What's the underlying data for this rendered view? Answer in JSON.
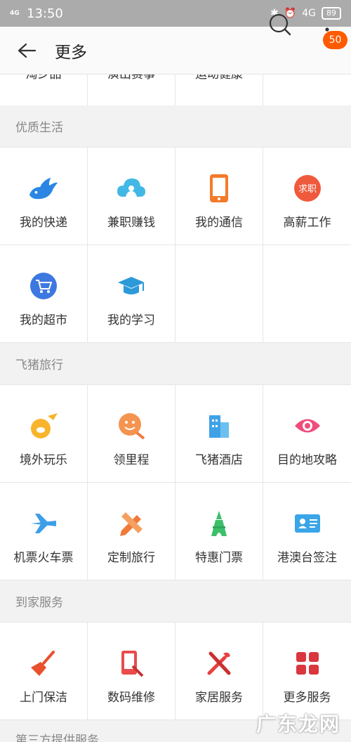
{
  "status_bar": {
    "network": "4G",
    "time": "13:50",
    "network2": "4G",
    "battery": "89"
  },
  "header": {
    "title": "更多",
    "badge": "50"
  },
  "top_partial_items": [
    "淘乡品",
    "演出赛事",
    "运动健康",
    ""
  ],
  "sections": [
    {
      "title": "优质生活",
      "items": [
        {
          "label": "我的快递",
          "icon": "bird-delivery-icon"
        },
        {
          "label": "兼职赚钱",
          "icon": "cloud-person-icon"
        },
        {
          "label": "我的通信",
          "icon": "phone-icon"
        },
        {
          "label": "高薪工作",
          "icon": "job-seek-icon",
          "icon_text": "求职"
        },
        {
          "label": "我的超市",
          "icon": "cart-icon"
        },
        {
          "label": "我的学习",
          "icon": "graduation-cap-icon"
        }
      ]
    },
    {
      "title": "飞猪旅行",
      "items": [
        {
          "label": "境外玩乐",
          "icon": "pig-plane-icon"
        },
        {
          "label": "领里程",
          "icon": "smiley-pen-icon"
        },
        {
          "label": "飞猪酒店",
          "icon": "building-icon"
        },
        {
          "label": "目的地攻略",
          "icon": "eye-icon"
        },
        {
          "label": "机票火车票",
          "icon": "airplane-icon"
        },
        {
          "label": "定制旅行",
          "icon": "pencil-ruler-icon"
        },
        {
          "label": "特惠门票",
          "icon": "tower-icon"
        },
        {
          "label": "港澳台签注",
          "icon": "id-card-icon"
        }
      ]
    },
    {
      "title": "到家服务",
      "items": [
        {
          "label": "上门保洁",
          "icon": "broom-icon"
        },
        {
          "label": "数码维修",
          "icon": "phone-repair-icon"
        },
        {
          "label": "家居服务",
          "icon": "tools-icon"
        },
        {
          "label": "更多服务",
          "icon": "grid-icon"
        }
      ]
    }
  ],
  "bottom_partial_section": "第三方提供服务",
  "watermark": "广东龙网",
  "colors": {
    "orange": "#ff5a00",
    "blue": "#2f7fe0",
    "gray_bg": "#f2f2f2"
  }
}
